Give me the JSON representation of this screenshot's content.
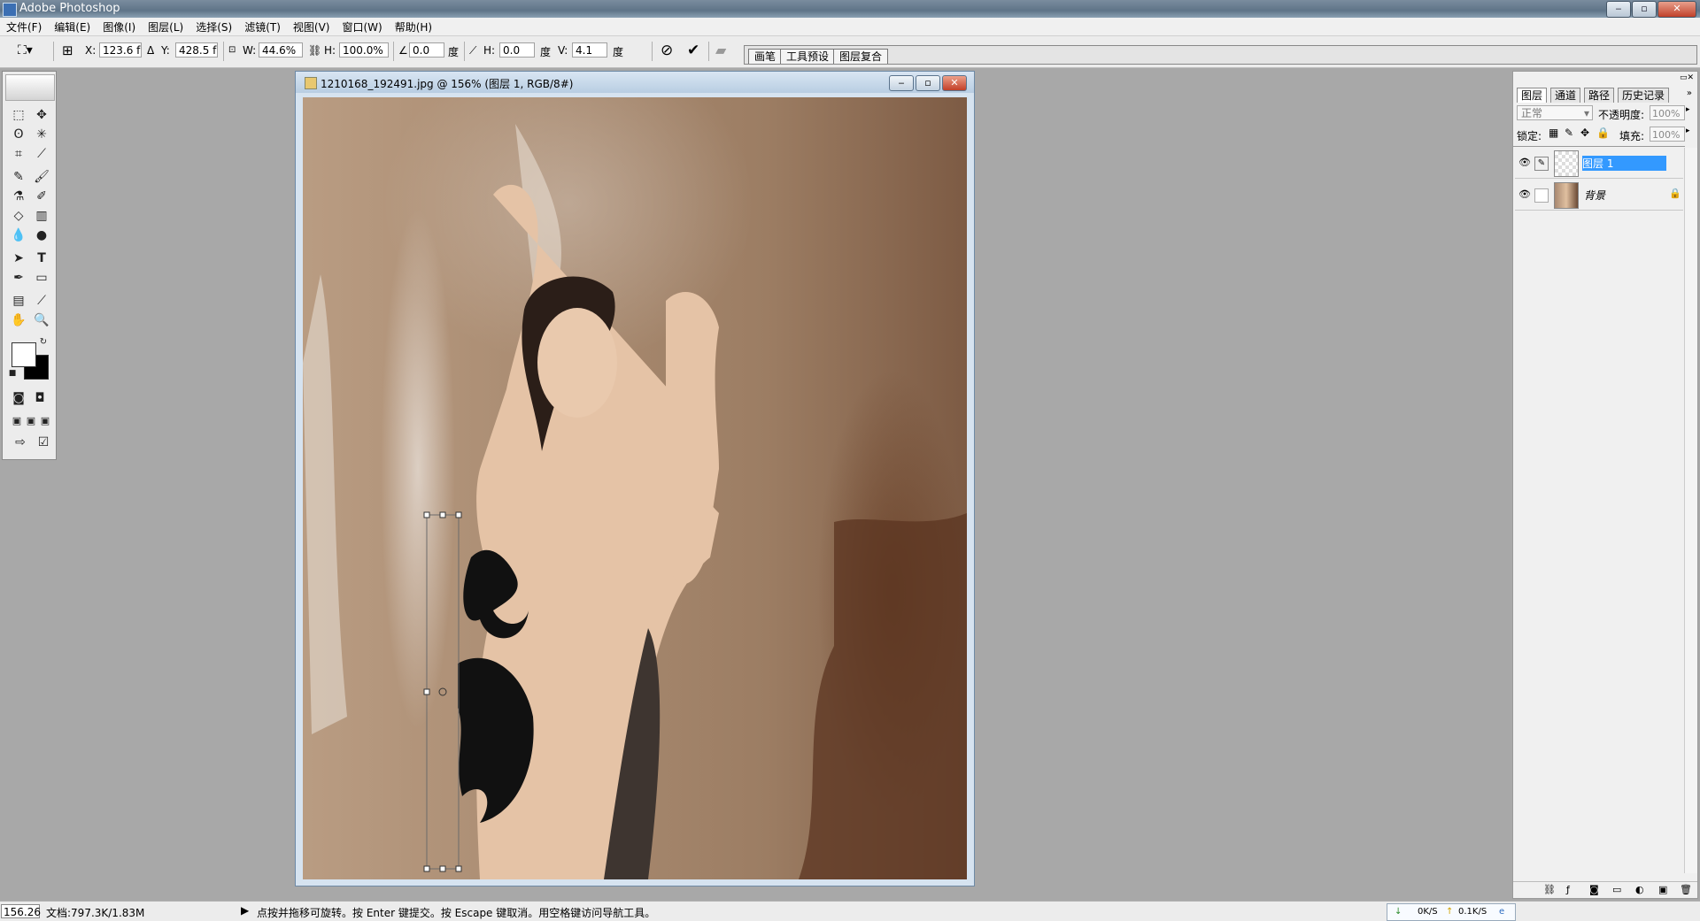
{
  "app": {
    "title": "Adobe Photoshop"
  },
  "menu": [
    "文件(F)",
    "编辑(E)",
    "图像(I)",
    "图层(L)",
    "选择(S)",
    "滤镜(T)",
    "视图(V)",
    "窗口(W)",
    "帮助(H)"
  ],
  "options": {
    "x_label": "X:",
    "x_value": "123.6 f",
    "y_label": "Y:",
    "y_value": "428.5 f",
    "w_label": "W:",
    "w_value": "44.6%",
    "h_label": "H:",
    "h_value": "100.0%",
    "angle_value": "0.0",
    "angle_unit": "度",
    "hskew_label": "H:",
    "hskew_value": "0.0",
    "hskew_unit": "度",
    "vskew_label": "V:",
    "vskew_value": "4.1",
    "vskew_unit": "度",
    "cancel_icon": "cancel-icon",
    "commit_icon": "checkmark-icon"
  },
  "palette_well": [
    "画笔",
    "工具预设",
    "图层复合"
  ],
  "document": {
    "title": "1210168_192491.jpg @ 156% (图层 1, RGB/8#)"
  },
  "layers_panel": {
    "tabs": [
      "图层",
      "通道",
      "路径",
      "历史记录"
    ],
    "blend_mode": "正常",
    "opacity_label": "不透明度:",
    "opacity_value": "100%",
    "lock_label": "锁定:",
    "fill_label": "填充:",
    "fill_value": "100%",
    "layers": [
      {
        "name": "图层 1",
        "selected": true
      },
      {
        "name": "背景",
        "selected": false
      }
    ]
  },
  "status": {
    "zoom": "156.26",
    "doc_info": "文档:797.3K/1.83M",
    "hint": "点按并拖移可旋转。按 Enter 键提交。按 Escape 键取消。用空格键访问导航工具。",
    "net_down": "0K/S",
    "net_up": "0.1K/S"
  }
}
